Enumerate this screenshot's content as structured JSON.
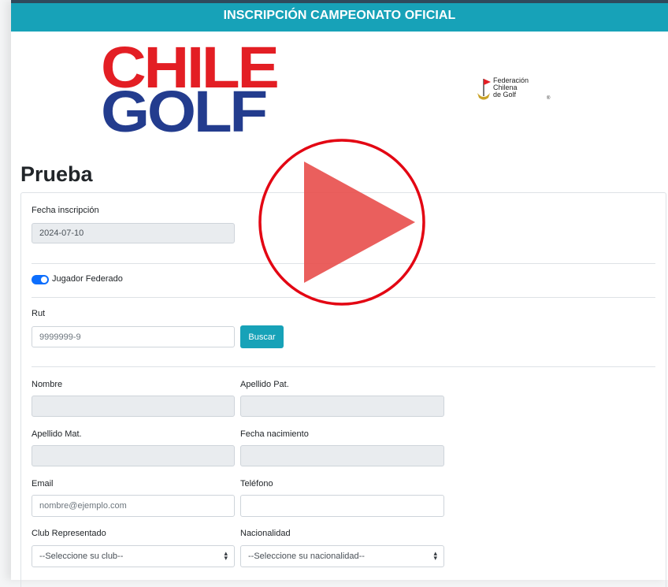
{
  "header": {
    "title": "INSCRIPCIÓN CAMPEONATO OFICIAL"
  },
  "logos": {
    "chile_golf_line1": "CHILE",
    "chile_golf_line2": "GOLF",
    "federation": [
      "Federación",
      "Chilena",
      "de Golf"
    ]
  },
  "page": {
    "title": "Prueba"
  },
  "form": {
    "fecha_inscripcion": {
      "label": "Fecha inscripción",
      "value": "2024-07-10"
    },
    "federado": {
      "label": "Jugador Federado",
      "checked": true
    },
    "rut": {
      "label": "Rut",
      "placeholder": "9999999-9"
    },
    "buscar_label": "Buscar",
    "nombre": {
      "label": "Nombre",
      "value": ""
    },
    "apellido_pat": {
      "label": "Apellido Pat.",
      "value": ""
    },
    "apellido_mat": {
      "label": "Apellido Mat.",
      "value": ""
    },
    "fecha_nacimiento": {
      "label": "Fecha nacimiento",
      "value": ""
    },
    "email": {
      "label": "Email",
      "placeholder": "nombre@ejemplo.com"
    },
    "telefono": {
      "label": "Teléfono",
      "value": ""
    },
    "club": {
      "label": "Club Representado",
      "selected": "--Seleccione su club--"
    },
    "nacionalidad": {
      "label": "Nacionalidad",
      "selected": "--Seleccione su nacionalidad--"
    }
  },
  "overlay": {
    "icon": "play-icon",
    "ring_color": "#e30613",
    "triangle_color": "#e8514f"
  },
  "colors": {
    "accent": "#17a2b8",
    "switch_on": "#0d6efd",
    "brand_red": "#e31e24",
    "brand_blue": "#233c8e"
  }
}
